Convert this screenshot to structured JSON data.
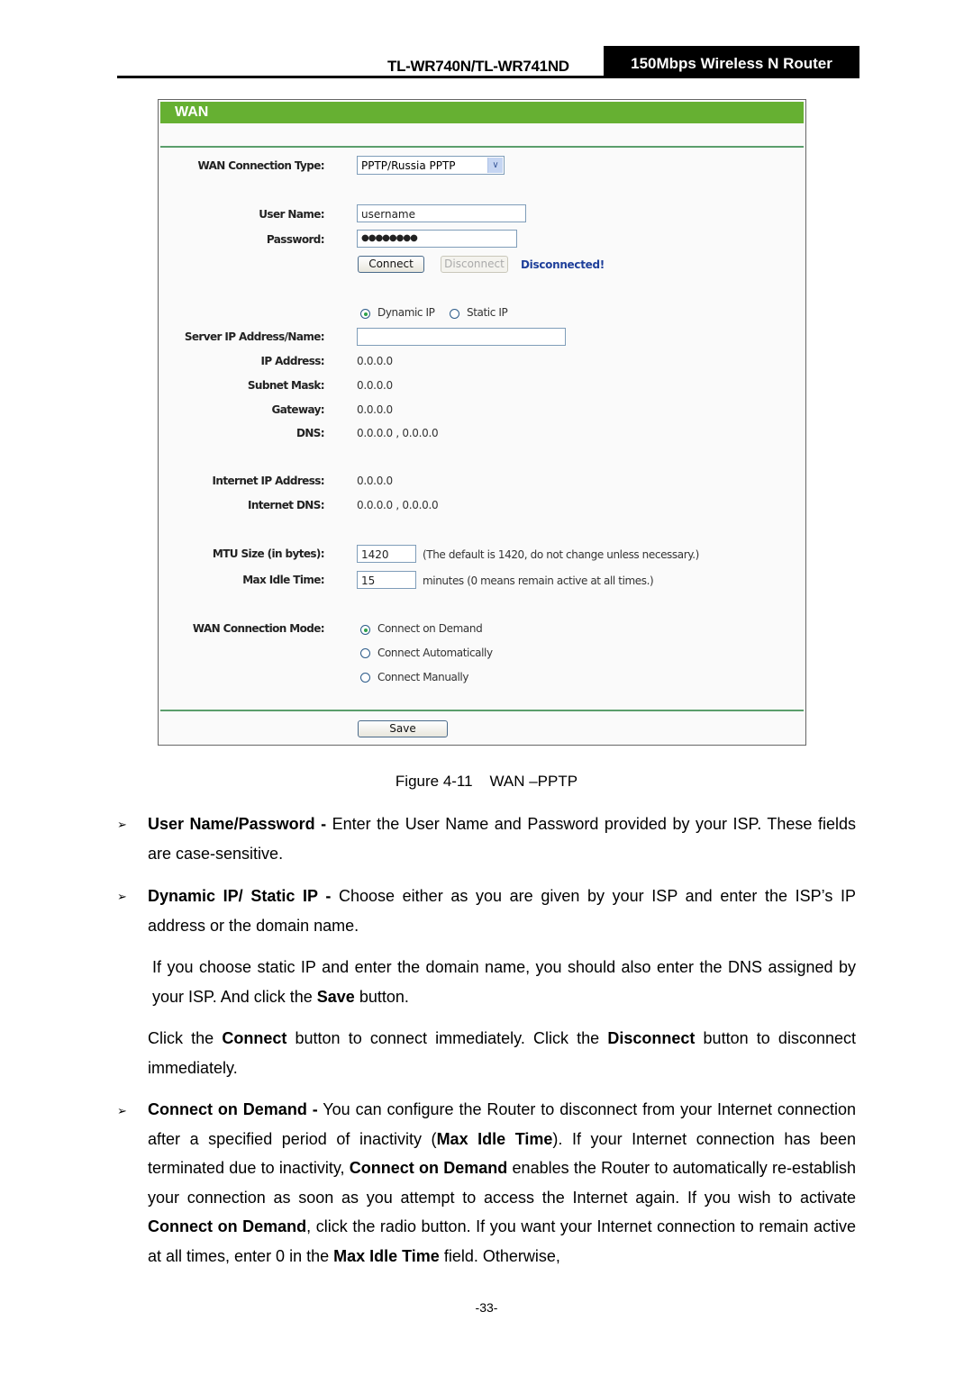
{
  "header": {
    "model": "TL-WR740N/TL-WR741ND",
    "product": "150Mbps Wireless N Router"
  },
  "panel": {
    "title": "WAN",
    "colors": {
      "title_bar": "#66b032",
      "divider": "#5b9e6c",
      "status": "#1e3f9a"
    },
    "wan_type_label": "WAN Connection Type:",
    "wan_type_value": "PPTP/Russia PPTP",
    "username_label": "User Name:",
    "username_value": "username",
    "password_label": "Password:",
    "password_value": "●●●●●●●●",
    "connect_button": "Connect",
    "disconnect_button": "Disconnect",
    "status": "Disconnected!",
    "ip_mode_options": [
      {
        "label": "Dynamic IP",
        "selected": true
      },
      {
        "label": "Static IP",
        "selected": false
      }
    ],
    "server_label": "Server IP Address/Name:",
    "server_value": "",
    "ip_label": "IP Address:",
    "ip_value": "0.0.0.0",
    "subnet_label": "Subnet Mask:",
    "subnet_value": "0.0.0.0",
    "gateway_label": "Gateway:",
    "gateway_value": "0.0.0.0",
    "dns_label": "DNS:",
    "dns_value": "0.0.0.0 , 0.0.0.0",
    "inet_ip_label": "Internet IP Address:",
    "inet_ip_value": "0.0.0.0",
    "inet_dns_label": "Internet DNS:",
    "inet_dns_value": "0.0.0.0 , 0.0.0.0",
    "mtu_label": "MTU Size (in bytes):",
    "mtu_value": "1420",
    "mtu_hint": "(The default is 1420, do not change unless necessary.)",
    "idle_label": "Max Idle Time:",
    "idle_value": "15",
    "idle_hint": "minutes (0 means remain active at all times.)",
    "mode_label": "WAN Connection Mode:",
    "mode_options": [
      {
        "label": "Connect on Demand",
        "selected": true
      },
      {
        "label": "Connect Automatically",
        "selected": false
      },
      {
        "label": "Connect Manually",
        "selected": false
      }
    ],
    "save_button": "Save"
  },
  "caption": "Figure 4-11    WAN –PPTP",
  "body": {
    "bullet_glyph": "➢",
    "p1_bold": "User Name/Password -",
    "p1_text": " Enter the User Name and Password provided by your ISP. These fields are case-sensitive.",
    "p2_bold": "Dynamic IP/ Static IP -",
    "p2_text": " Choose either as you are given by your ISP and enter the ISP’s IP address or the domain name.",
    "p3_text1": "If you choose static IP and enter the domain name, you should also enter the DNS assigned by your ISP. And click the ",
    "p3_bold": "Save",
    "p3_text2": " button.",
    "p4_text1": "Click the ",
    "p4_bold1": "Connect",
    "p4_text2": " button to connect immediately. Click the ",
    "p4_bold2": "Disconnect",
    "p4_text3": " button to disconnect immediately.",
    "p5_bold1": "Connect on Demand -",
    "p5_text1": " You can configure the Router to disconnect from your Internet connection after a specified period of inactivity (",
    "p5_bold2": "Max Idle Time",
    "p5_text2": "). If your Internet connection has been terminated due to inactivity, ",
    "p5_bold3": "Connect on Demand",
    "p5_text3": " enables the Router to automatically re-establish your connection as soon as you attempt to access the Internet again. If you wish to activate ",
    "p5_bold4": "Connect on Demand",
    "p5_text4": ", click the radio button. If you want your Internet connection to remain active at all times, enter 0 in the ",
    "p5_bold5": "Max Idle Time",
    "p5_text5": " field. Otherwise,"
  },
  "page_number": "-33-"
}
